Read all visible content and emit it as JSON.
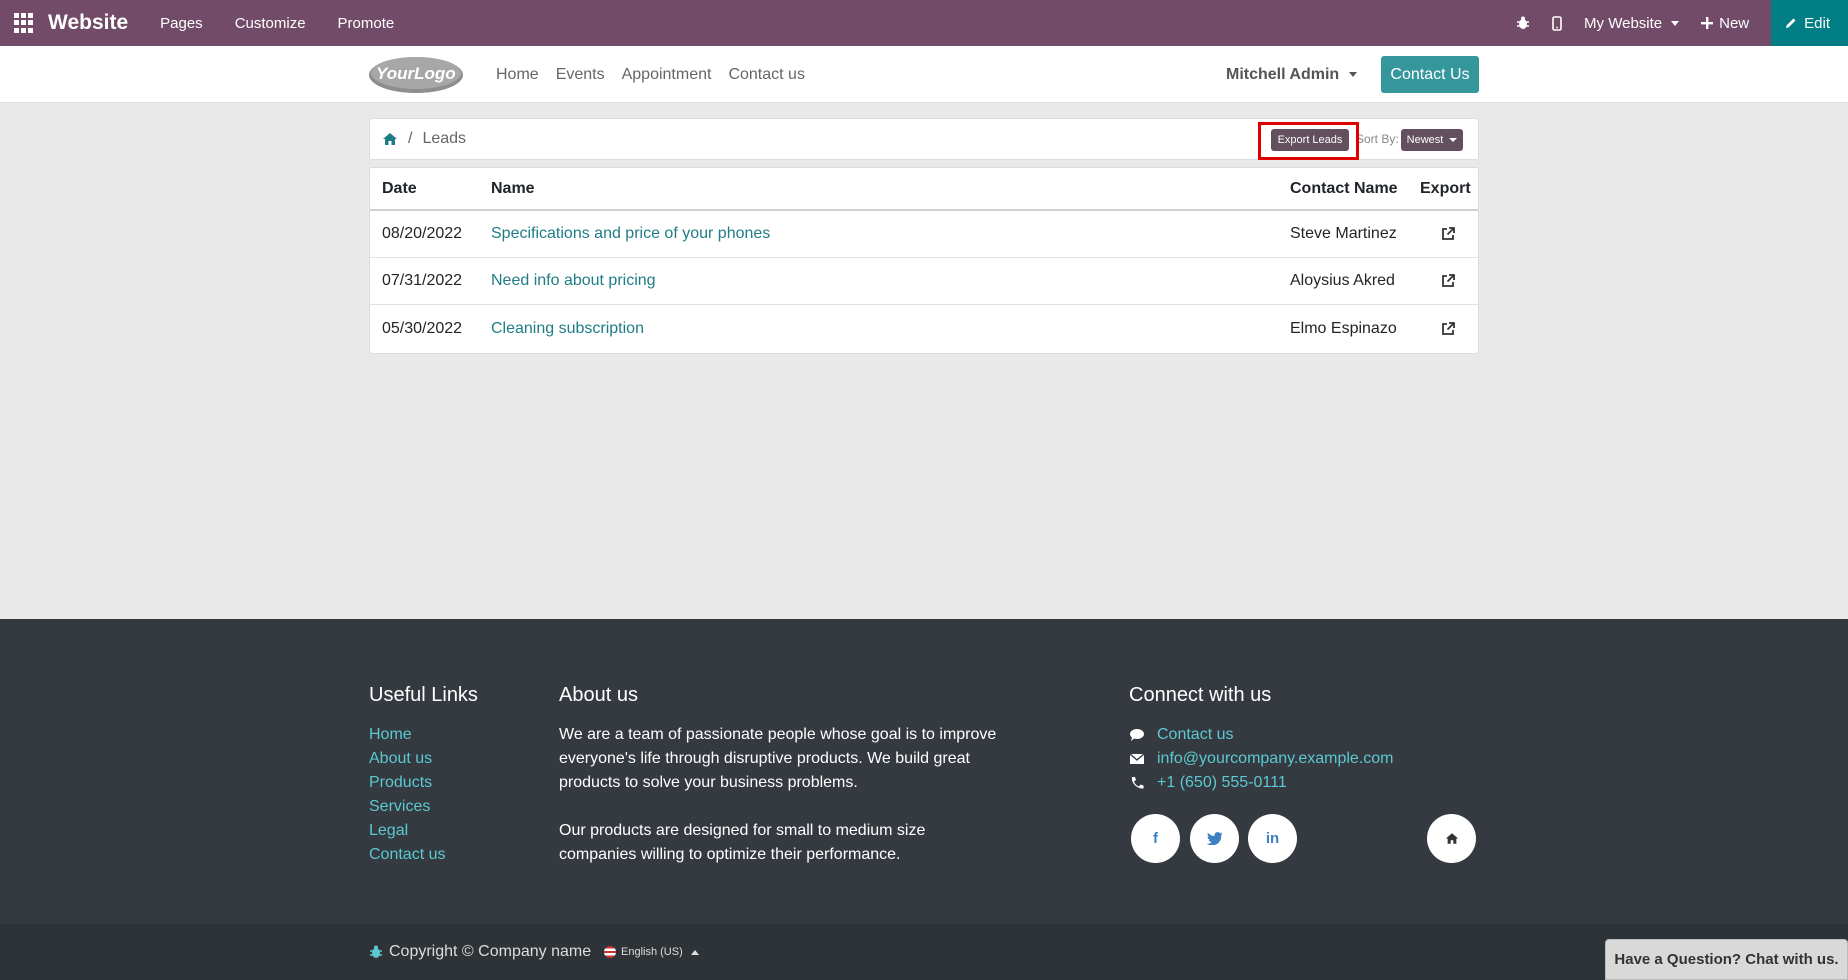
{
  "adminbar": {
    "brand": "Website",
    "menus": [
      "Pages",
      "Customize",
      "Promote"
    ],
    "my_website": "My Website",
    "new_label": "New",
    "edit_label": "Edit"
  },
  "navbar": {
    "logo_text": "YourLogo",
    "links": [
      "Home",
      "Events",
      "Appointment",
      "Contact us"
    ],
    "user": "Mitchell Admin",
    "contact_button": "Contact Us"
  },
  "breadcrumb": {
    "separator": "/",
    "current": "Leads",
    "export_button": "Export Leads",
    "sort_label": "Sort By:",
    "sort_value": "Newest"
  },
  "table": {
    "headers": [
      "Date",
      "Name",
      "Contact Name",
      "Export"
    ],
    "rows": [
      {
        "date": "08/20/2022",
        "name": "Specifications and price of your phones",
        "contact": "Steve Martinez"
      },
      {
        "date": "07/31/2022",
        "name": "Need info about pricing",
        "contact": "Aloysius Akred"
      },
      {
        "date": "05/30/2022",
        "name": "Cleaning subscription",
        "contact": "Elmo Espinazo"
      }
    ]
  },
  "footer": {
    "useful_links_title": "Useful Links",
    "useful_links": [
      "Home",
      "About us",
      "Products",
      "Services",
      "Legal",
      "Contact us"
    ],
    "about_title": "About us",
    "about_p1": "We are a team of passionate people whose goal is to improve everyone's life through disruptive products. We build great products to solve your business problems.",
    "about_p2": "Our products are designed for small to medium size companies willing to optimize their performance.",
    "connect_title": "Connect with us",
    "contact_link": "Contact us",
    "email": "info@yourcompany.example.com",
    "phone": "+1 (650) 555-0111",
    "social": {
      "facebook": "f",
      "linkedin": "in"
    }
  },
  "copyright": {
    "text": "Copyright © Company name",
    "language": "English (US)"
  },
  "chat": {
    "label": "Have a Question? Chat with us."
  },
  "colors": {
    "admin_bar": "#714b67",
    "edit": "#017e84",
    "accent": "#35979c",
    "link": "#1f7d86",
    "footer": "#343a40",
    "highlight": "#e00000"
  }
}
